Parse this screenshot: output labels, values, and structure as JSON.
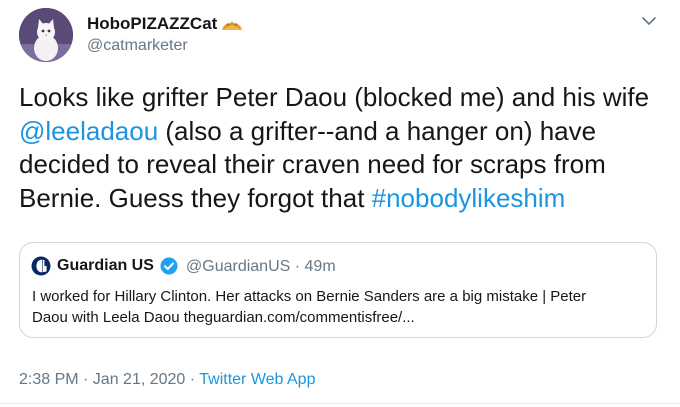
{
  "author": {
    "display_name": "HoboPIZAZZCat",
    "name_emoji": "taco-emoji",
    "handle": "@catmarketer"
  },
  "tweet": {
    "line1": "Looks like grifter Peter Daou (blocked me) and his wife",
    "mention": "@leeladaou",
    "line2_rest": " (also a grifter--and a hanger on) have",
    "line3": "decided to reveal their craven need for scraps from",
    "line4_start": "Bernie. Guess they forgot that ",
    "hashtag": "#nobodylikeshim"
  },
  "quoted": {
    "name": "Guardian US",
    "handle": "@GuardianUS",
    "separator": " · ",
    "time": "49m",
    "text_line1": "I worked for Hillary Clinton. Her attacks on Bernie Sanders are a big mistake | Peter",
    "text_line2": "Daou with Leela Daou theguardian.com/commentisfree/..."
  },
  "meta": {
    "timestamp": "2:38 PM · Jan 21, 2020",
    "separator": " · ",
    "source": "Twitter Web App"
  },
  "colors": {
    "link": "#1b95e0",
    "secondary_text": "#657786",
    "border": "#ccd6dd"
  }
}
